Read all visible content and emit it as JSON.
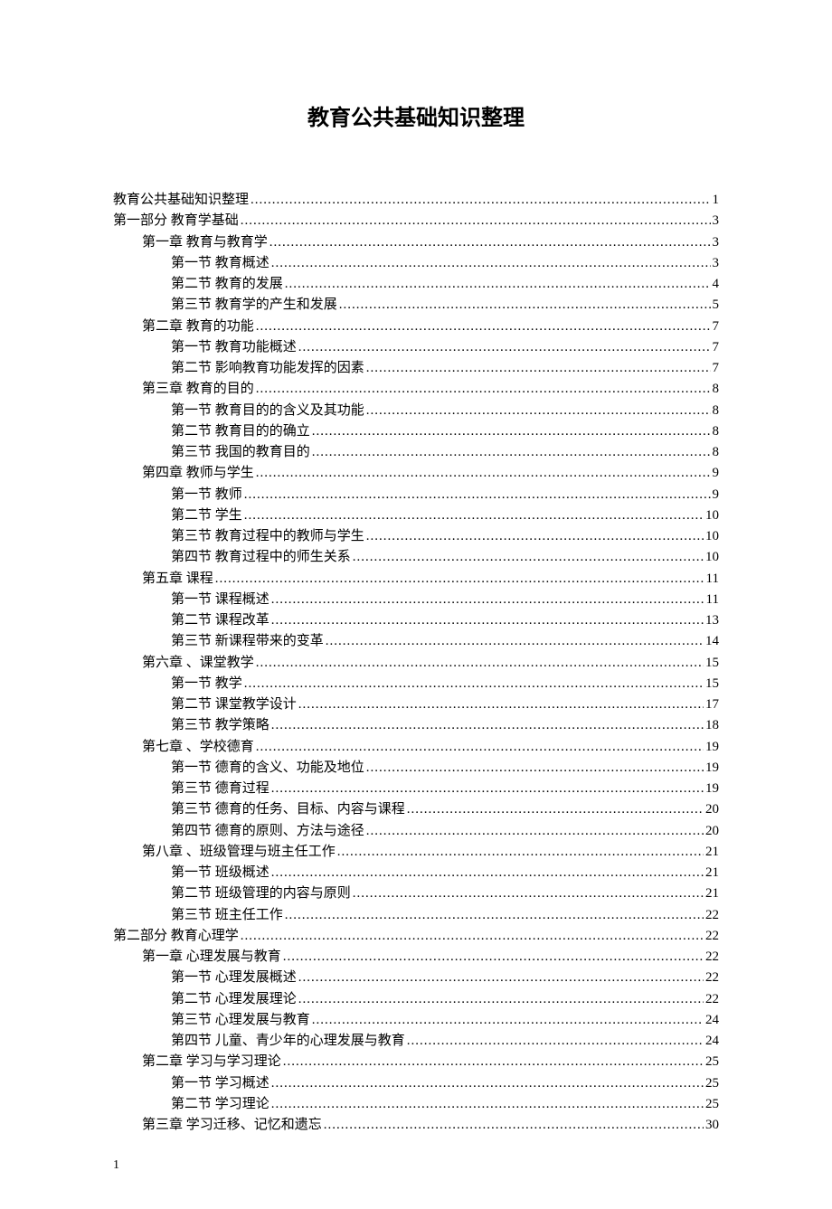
{
  "title": "教育公共基础知识整理",
  "page_number": "1",
  "toc": [
    {
      "indent": 0,
      "label": "教育公共基础知识整理",
      "page": "1"
    },
    {
      "indent": 0,
      "label": "第一部分  教育学基础",
      "page": "3"
    },
    {
      "indent": 1,
      "label": "第一章  教育与教育学",
      "page": "3"
    },
    {
      "indent": 2,
      "label": "第一节 教育概述",
      "page": "3"
    },
    {
      "indent": 2,
      "label": "第二节  教育的发展",
      "page": "4"
    },
    {
      "indent": 2,
      "label": "第三节  教育学的产生和发展",
      "page": "5"
    },
    {
      "indent": 1,
      "label": "第二章  教育的功能",
      "page": "7"
    },
    {
      "indent": 2,
      "label": "第一节 教育功能概述",
      "page": "7"
    },
    {
      "indent": 2,
      "label": "第二节 影响教育功能发挥的因素",
      "page": "7"
    },
    {
      "indent": 1,
      "label": "第三章  教育的目的",
      "page": "8"
    },
    {
      "indent": 2,
      "label": "第一节 教育目的的含义及其功能",
      "page": "8"
    },
    {
      "indent": 2,
      "label": "第二节 教育目的的确立",
      "page": "8"
    },
    {
      "indent": 2,
      "label": "第三节 我国的教育目的",
      "page": "8"
    },
    {
      "indent": 1,
      "label": "第四章  教师与学生",
      "page": "9"
    },
    {
      "indent": 2,
      "label": "第一节 教师",
      "page": "9"
    },
    {
      "indent": 2,
      "label": "第二节 学生",
      "page": "10"
    },
    {
      "indent": 2,
      "label": "第三节 教育过程中的教师与学生",
      "page": "10"
    },
    {
      "indent": 2,
      "label": "第四节  教育过程中的师生关系",
      "page": "10"
    },
    {
      "indent": 1,
      "label": "第五章  课程",
      "page": "11"
    },
    {
      "indent": 2,
      "label": "第一节 课程概述",
      "page": "11"
    },
    {
      "indent": 2,
      "label": "第二节  课程改革",
      "page": "13"
    },
    {
      "indent": 2,
      "label": "第三节  新课程带来的变革",
      "page": "14"
    },
    {
      "indent": 1,
      "label": "第六章 、课堂教学",
      "page": "15"
    },
    {
      "indent": 2,
      "label": "第一节 教学",
      "page": "15"
    },
    {
      "indent": 2,
      "label": "第二节 课堂教学设计",
      "page": "17"
    },
    {
      "indent": 2,
      "label": "第三节 教学策略",
      "page": "18"
    },
    {
      "indent": 1,
      "label": "第七章 、学校德育",
      "page": "19"
    },
    {
      "indent": 2,
      "label": "第一节 德育的含义、功能及地位",
      "page": "19"
    },
    {
      "indent": 2,
      "label": "第三节 德育过程",
      "page": "19"
    },
    {
      "indent": 2,
      "label": "第三节 德育的任务、目标、内容与课程",
      "page": "20"
    },
    {
      "indent": 2,
      "label": "第四节 德育的原则、方法与途径",
      "page": "20"
    },
    {
      "indent": 1,
      "label": "第八章 、班级管理与班主任工作",
      "page": "21"
    },
    {
      "indent": 2,
      "label": "第一节 班级概述",
      "page": "21"
    },
    {
      "indent": 2,
      "label": "第二节 班级管理的内容与原则",
      "page": "21"
    },
    {
      "indent": 2,
      "label": "第三节  班主任工作",
      "page": "22"
    },
    {
      "indent": 0,
      "label": "第二部分  教育心理学",
      "page": "22"
    },
    {
      "indent": 1,
      "label": "第一章  心理发展与教育",
      "page": "22"
    },
    {
      "indent": 2,
      "label": "第一节  心理发展概述",
      "page": "22"
    },
    {
      "indent": 2,
      "label": "第二节 心理发展理论",
      "page": "22"
    },
    {
      "indent": 2,
      "label": "第三节 心理发展与教育",
      "page": "24"
    },
    {
      "indent": 2,
      "label": "第四节 儿童、青少年的心理发展与教育",
      "page": "24"
    },
    {
      "indent": 1,
      "label": "第二章 学习与学习理论",
      "page": "25"
    },
    {
      "indent": 2,
      "label": "第一节  学习概述",
      "page": "25"
    },
    {
      "indent": 2,
      "label": "第二节 学习理论",
      "page": "25"
    },
    {
      "indent": 1,
      "label": "第三章  学习迁移、记忆和遗忘",
      "page": "30"
    }
  ]
}
